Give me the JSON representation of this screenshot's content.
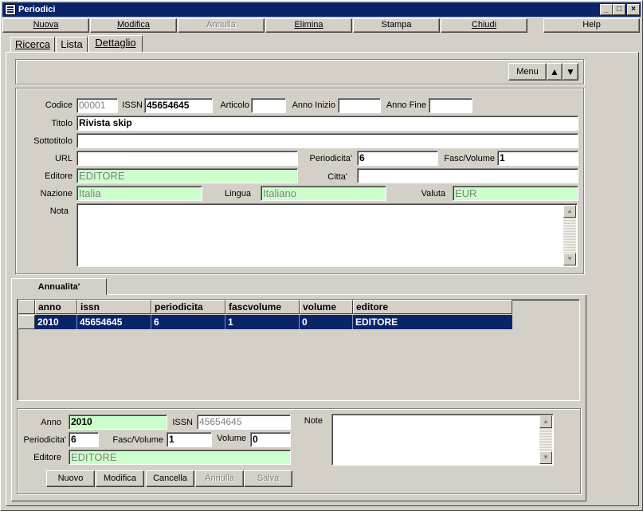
{
  "window": {
    "title": "Periodici"
  },
  "toolbar": {
    "buttons": [
      "Nuova",
      "Modifica",
      "Annulla",
      "Elimina",
      "Stampa",
      "Chiudi",
      "Help"
    ]
  },
  "tabs": [
    "Ricerca",
    "Lista",
    "Dettaglio"
  ],
  "nav": {
    "menu_label": "Menu"
  },
  "form": {
    "codice_label": "Codice",
    "codice": "00001",
    "issn_label": "ISSN",
    "issn": "45654645",
    "articolo_label": "Articolo",
    "articolo": "",
    "anno_inizio_label": "Anno Inizio",
    "anno_inizio": "",
    "anno_fine_label": "Anno Fine",
    "anno_fine": "",
    "titolo_label": "Titolo",
    "titolo": "Rivista skip",
    "sottotitolo_label": "Sottotitolo",
    "sottotitolo": "",
    "url_label": "URL",
    "url": "",
    "periodicita_label": "Periodicita'",
    "periodicita": "6",
    "fasc_label": "Fasc/Volume",
    "fasc": "1",
    "editore_label": "Editore",
    "editore": "EDITORE",
    "citta_label": "Citta'",
    "citta": "",
    "nazione_label": "Nazione",
    "nazione": "Italia",
    "lingua_label": "Lingua",
    "lingua": "Italiano",
    "valuta_label": "Valuta",
    "valuta": "EUR",
    "nota_label": "Nota",
    "nota": ""
  },
  "annualita": {
    "tab_label": "Annualita'",
    "columns": [
      "anno",
      "issn",
      "periodicita",
      "fascvolume",
      "volume",
      "editore"
    ],
    "rows": [
      [
        "2010",
        "45654645",
        "6",
        "1",
        "0",
        "EDITORE"
      ]
    ]
  },
  "detail": {
    "anno_label": "Anno",
    "anno": "2010",
    "issn_label": "ISSN",
    "issn": "45654645",
    "note_label": "Note",
    "note": "",
    "periodicita_label": "Periodicita'",
    "periodicita": "6",
    "fasc_label": "Fasc/Volume",
    "fasc": "1",
    "volume_label": "Volume",
    "volume": "0",
    "editore_label": "Editore",
    "editore": "EDITORE",
    "buttons": [
      "Nuovo",
      "Modifica",
      "Cancella",
      "Annulla",
      "Salva"
    ]
  }
}
